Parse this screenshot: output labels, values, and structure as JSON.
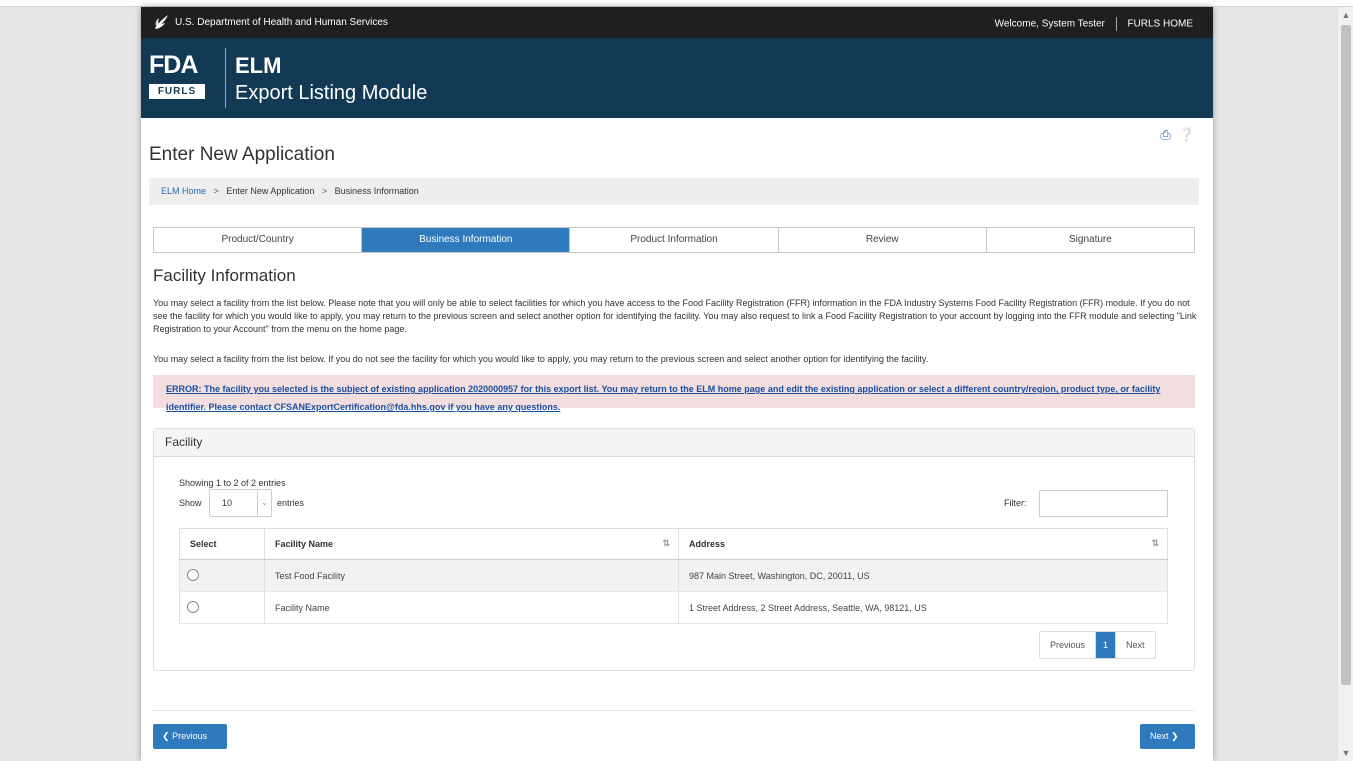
{
  "govbar": {
    "agency": "U.S. Department of Health and Human Services",
    "welcome": "Welcome, System Tester",
    "home_link": "FURLS HOME"
  },
  "header": {
    "logo_text": "FDA",
    "logo_sub": "FURLS",
    "app_abbr": "ELM",
    "app_name": "Export Listing Module"
  },
  "page_title": "Enter New Application",
  "breadcrumb": [
    "ELM Home",
    "Enter New Application",
    "Business Information"
  ],
  "steps": [
    "Product/Country",
    "Business Information",
    "Product Information",
    "Review",
    "Signature"
  ],
  "active_step": "Business Information",
  "section_title": "Facility Information",
  "paragraph1": "You may select a facility from the list below. Please note that you will only be able to select facilities for which you have access to the Food Facility Registration (FFR) information in the FDA Industry Systems Food Facility Registration (FFR) module. If you do not see the facility for which you would like to apply, you may return to the previous screen and select another option for identifying the facility. You may also request to link a Food Facility Registration to your account by logging into the FFR module and selecting \"Link Registration to your Account\" from the menu on the home page.",
  "paragraph2": "You may select a facility from the list below. If you do not see the facility for which you would like to apply, you may return to the previous screen and select another option for identifying the facility.",
  "error": "ERROR: The facility you selected is the subject of existing application 2020000957 for this export list. You may return to the ELM home page and edit the existing application or select a different country/region, product type, or facility identifier. Please contact CFSANExportCertification@fda.hhs.gov if you have any questions.",
  "panel": {
    "title": "Facility",
    "showing": "Showing 1 to 2 of 2 entries",
    "show_label": "Show",
    "page_size": "10",
    "entries_label": "entries",
    "filter_label": "Filter:",
    "filter_value": "",
    "columns": [
      "Select",
      "Facility Name",
      "Address"
    ],
    "rows": [
      {
        "name": "Test Food Facility",
        "address": "987 Main Street, Washington, DC, 20011, US"
      },
      {
        "name": "Facility Name",
        "address": "1 Street Address, 2 Street Address, Seattle, WA, 98121, US"
      }
    ],
    "pager": {
      "previous": "Previous",
      "current": "1",
      "next": "Next"
    }
  },
  "nav": {
    "previous": "Previous",
    "next": "Next"
  },
  "colors": {
    "header_bg": "#133a55",
    "accent": "#2f79bd",
    "error_bg": "#f2dede"
  }
}
